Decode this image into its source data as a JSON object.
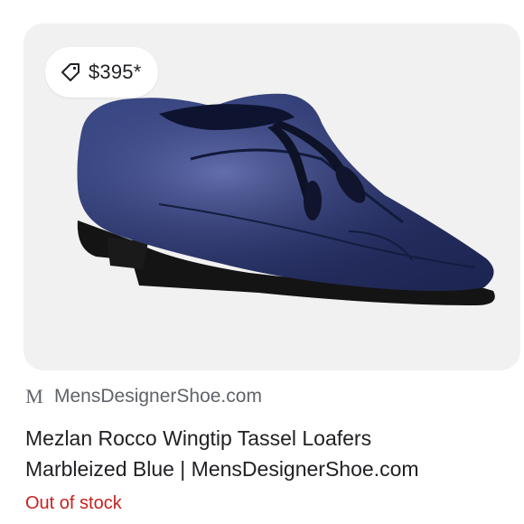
{
  "price_chip": {
    "icon": "tag-icon",
    "price": "$395*"
  },
  "image": {
    "subject": ""
  },
  "source": {
    "favicon_letter": "M",
    "name": "MensDesignerShoe.com"
  },
  "product": {
    "title_line1": "Mezlan Rocco Wingtip Tassel Loafers",
    "title_line2": "Marbleized Blue | MensDesignerShoe.com"
  },
  "availability": {
    "status": "Out of stock"
  },
  "colors": {
    "stock_red": "#c5221f",
    "secondary_text": "#5f6368",
    "card_bg": "#f1f1f1"
  }
}
